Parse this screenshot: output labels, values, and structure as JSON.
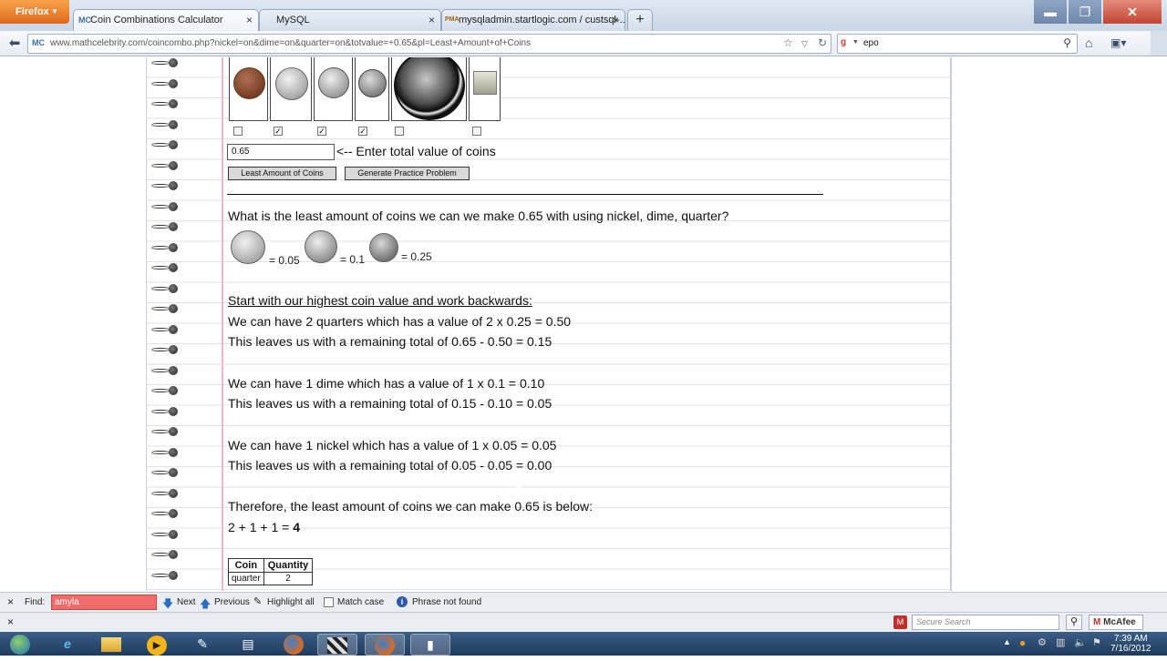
{
  "browser": {
    "menu_label": "Firefox",
    "tabs": [
      {
        "icon": "MC",
        "label": "Coin Combinations Calculator",
        "close": "×"
      },
      {
        "icon": "",
        "label": "MySQL",
        "close": "×"
      },
      {
        "icon": "PMA",
        "label": "mysqladmin.startlogic.com / custsql-...",
        "close": "×"
      }
    ],
    "new_tab": "+",
    "window_controls": {
      "minimize": "▬",
      "maximize": "❐",
      "close": "✕"
    },
    "url": "www.mathcelebrity.com/coincombo.php?nickel=on&dime=on&quarter=on&totvalue=+0.65&pl=Least+Amount+of+Coins",
    "site_icon": "MC",
    "search_engine_icon": "g",
    "search_text": "epo"
  },
  "page": {
    "checkboxes": [
      false,
      true,
      true,
      true,
      false,
      false
    ],
    "total_value": "0.65",
    "total_hint": "<-- Enter total value of coins",
    "buttons": {
      "least": "Least Amount of Coins",
      "practice": "Generate Practice Problem"
    },
    "question": "What is the least amount of coins we can we make 0.65 with using nickel, dime, quarter?",
    "coin_values": {
      "nickel": "= 0.05",
      "dime": "= 0.1",
      "quarter": "= 0.25"
    },
    "intro": "Start with our highest coin value and work backwards:",
    "steps": [
      "We can have 2 quarters which has a value of 2 x 0.25 = 0.50",
      "This leaves us with a remaining total of 0.65 - 0.50 = 0.15",
      "We can have 1 dime which has a value of 1 x 0.1 = 0.10",
      "This leaves us with a remaining total of 0.15 - 0.10 = 0.05",
      "We can have 1 nickel which has a value of 1 x 0.05 = 0.05",
      "This leaves us with a remaining total of 0.05 - 0.05 = 0.00"
    ],
    "conclusion": "Therefore, the least amount of coins we can make 0.65 is below:",
    "sum_expression": "2 + 1 + 1 = ",
    "sum_total": "4",
    "table": {
      "headers": [
        "Coin",
        "Quantity"
      ],
      "rows": [
        [
          "quarter",
          "2"
        ]
      ]
    }
  },
  "findbar": {
    "close": "×",
    "label": "Find:",
    "query": "amyla",
    "next": "Next",
    "previous": "Previous",
    "highlight_all": "Highlight all",
    "match_case": "Match case",
    "status": "Phrase not found"
  },
  "addonbar": {
    "close": "×",
    "secure_search_placeholder": "Secure Search",
    "mcafee": "McAfee"
  },
  "taskbar": {
    "time": "7:39 AM",
    "date": "7/16/2012"
  },
  "colors": {
    "find_not_found_bg": "#f36a6a",
    "firefox_orange": "#e0691a",
    "notebook_margin": "#f3b6c2"
  }
}
